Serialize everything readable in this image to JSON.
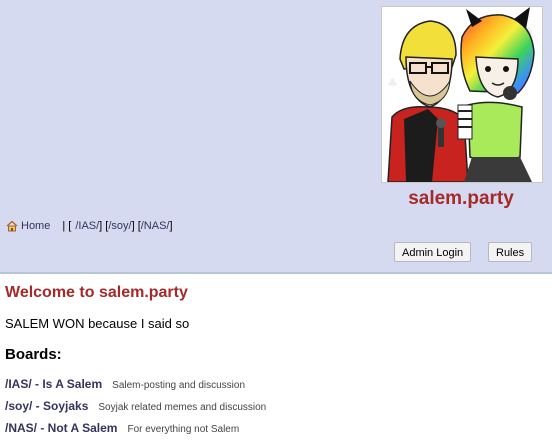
{
  "header": {
    "site_title": "salem.party",
    "banner_alt": "salem.party banner"
  },
  "nav": {
    "home_icon": "home-icon",
    "home_label": "Home",
    "separator": "| [",
    "boards": [
      {
        "label": "/IAS/",
        "suffix": "] ["
      },
      {
        "label": "/soy/",
        "suffix": "] ["
      },
      {
        "label": "/NAS/",
        "suffix": "]"
      }
    ]
  },
  "buttons": {
    "admin_login": "Admin Login",
    "rules": "Rules"
  },
  "main": {
    "welcome": "Welcome to salem.party",
    "message": "SALEM WON because I said so",
    "boards_heading": "Boards:",
    "boards": [
      {
        "name": "/IAS/ - Is A Salem",
        "description": "Salem-posting and discussion"
      },
      {
        "name": "/soy/ - Soyjaks",
        "description": "Soyjak related memes and discussion"
      },
      {
        "name": "/NAS/ - Not A Salem",
        "description": "For everything not Salem"
      }
    ]
  },
  "colors": {
    "header_bg": "#d6daf0",
    "title_red": "#a52a2a",
    "link": "#34345c"
  }
}
